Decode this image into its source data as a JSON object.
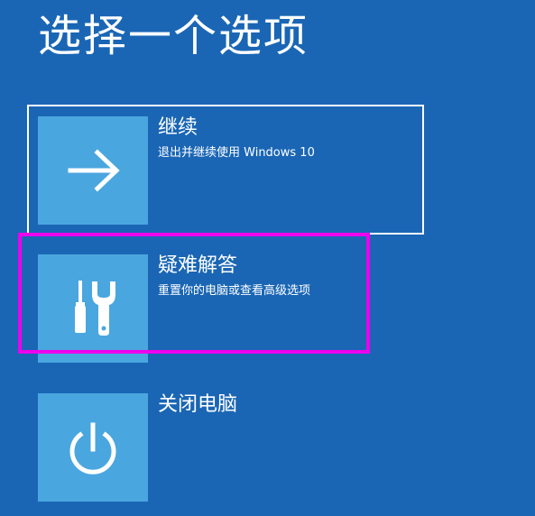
{
  "page": {
    "title": "选择一个选项"
  },
  "options": [
    {
      "label": "继续",
      "description": "退出并继续使用 Windows 10",
      "icon": "arrow-right-icon"
    },
    {
      "label": "疑难解答",
      "description": "重置你的电脑或查看高级选项",
      "icon": "tools-icon"
    },
    {
      "label": "关闭电脑",
      "description": "",
      "icon": "power-icon"
    }
  ],
  "colors": {
    "background": "#1a66b5",
    "tile": "#4aa6df",
    "text": "#ffffff",
    "focus_outline": "#ffffff",
    "highlight_annotation": "#ee00ee"
  }
}
